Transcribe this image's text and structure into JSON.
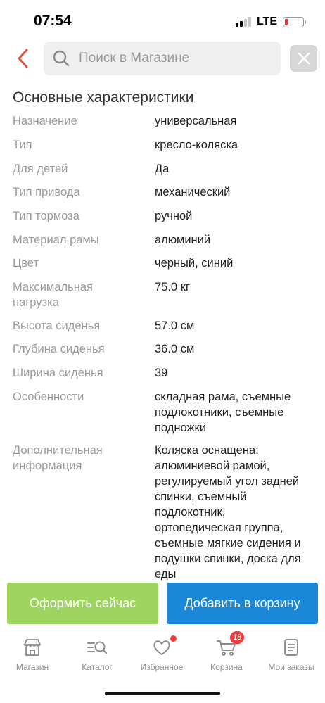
{
  "status_bar": {
    "time": "07:54",
    "network": "LTE"
  },
  "search": {
    "placeholder": "Поиск в Магазине"
  },
  "section_title": "Основные характеристики",
  "specs": [
    {
      "label": "Назначение",
      "value": "универсальная"
    },
    {
      "label": "Тип",
      "value": "кресло-коляска"
    },
    {
      "label": "Для детей",
      "value": "Да"
    },
    {
      "label": "Тип привода",
      "value": "механический"
    },
    {
      "label": "Тип тормоза",
      "value": "ручной"
    },
    {
      "label": "Материал рамы",
      "value": "алюминий"
    },
    {
      "label": "Цвет",
      "value": "черный, синий"
    },
    {
      "label": "Максимальная нагрузка",
      "value": "75.0 кг"
    },
    {
      "label": "Высота сиденья",
      "value": "57.0 см"
    },
    {
      "label": "Глубина сиденья",
      "value": "36.0 см"
    },
    {
      "label": "Ширина сиденья",
      "value": "39"
    },
    {
      "label": "Особенности",
      "value": "складная рама, съемные подлокотники, съемные подножки"
    },
    {
      "label": "Дополнительная информация",
      "value": "Коляска оснащена: алюминиевой рамой, регулируемый угол задней спинки, съемный подлокотник, ортопедическая группа, съемные мягкие сидения и подушки спинки, доска для еды"
    }
  ],
  "actions": {
    "buy_now": "Оформить сейчас",
    "add_to_cart": "Добавить в корзину"
  },
  "tabs": [
    {
      "label": "Магазин",
      "icon": "store-icon"
    },
    {
      "label": "Каталог",
      "icon": "catalog-search-icon"
    },
    {
      "label": "Избранное",
      "icon": "heart-icon"
    },
    {
      "label": "Корзина",
      "icon": "cart-icon",
      "badge": "18"
    },
    {
      "label": "Мои заказы",
      "icon": "orders-icon"
    }
  ],
  "colors": {
    "accent_green": "#a0d460",
    "accent_blue": "#1b87d8",
    "back_arrow": "#e0533d",
    "badge_red": "#ee3a3a"
  }
}
